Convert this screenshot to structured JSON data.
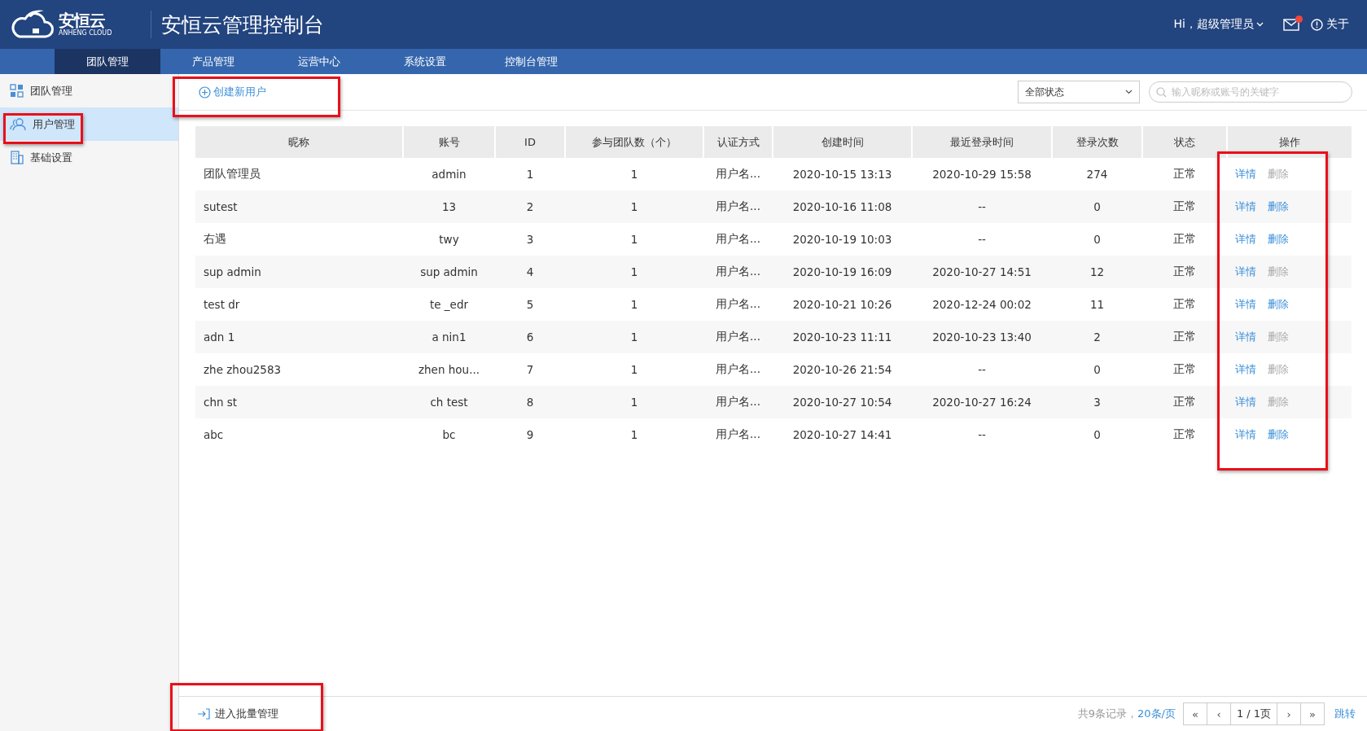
{
  "header": {
    "logo_text": "安恒云",
    "logo_subtext": "ANHENG CLOUD",
    "title": "安恒云管理控制台",
    "greeting": "Hi，超级管理员",
    "mail_unread": true,
    "about": "关于"
  },
  "nav": [
    {
      "label": "团队管理",
      "selected": true
    },
    {
      "label": "产品管理",
      "selected": false
    },
    {
      "label": "运营中心",
      "selected": false
    },
    {
      "label": "系统设置",
      "selected": false
    },
    {
      "label": "控制台管理",
      "selected": false
    }
  ],
  "sidebar": {
    "items": [
      {
        "label": "团队管理",
        "kind": "grid",
        "selected": false
      },
      {
        "label": "用户管理",
        "kind": "users",
        "selected": true
      },
      {
        "label": "基础设置",
        "kind": "building",
        "selected": false
      }
    ]
  },
  "toolbar": {
    "create_button": "创建新用户",
    "status_filter": "全部状态",
    "search": {
      "placeholder": "输入昵称或账号的关键字"
    }
  },
  "table": {
    "columns": [
      "昵称",
      "账号",
      "ID",
      "参与团队数（个）",
      "认证方式",
      "创建时间",
      "最近登录时间",
      "登录次数",
      "状态",
      "操作"
    ],
    "rows": [
      {
        "cells": [
          "团队管理员",
          "admin",
          "1",
          "1",
          "用户名...",
          "2020-10-15 13:13",
          "2020-10-29 15:58",
          "274",
          "正常"
        ],
        "actions": [
          {
            "label": "详情",
            "disabled": false
          },
          {
            "label": "删除",
            "disabled": true
          }
        ]
      },
      {
        "cells": [
          "sutest",
          "13",
          "2",
          "1",
          "用户名...",
          "2020-10-16 11:08",
          "--",
          "0",
          "正常"
        ],
        "actions": [
          {
            "label": "详情",
            "disabled": false
          },
          {
            "label": "删除",
            "disabled": false
          }
        ]
      },
      {
        "cells": [
          "右遇",
          "twy",
          "3",
          "1",
          "用户名...",
          "2020-10-19 10:03",
          "--",
          "0",
          "正常"
        ],
        "actions": [
          {
            "label": "详情",
            "disabled": false
          },
          {
            "label": "删除",
            "disabled": false
          }
        ]
      },
      {
        "cells": [
          "sup admin",
          "sup admin",
          "4",
          "1",
          "用户名...",
          "2020-10-19 16:09",
          "2020-10-27 14:51",
          "12",
          "正常"
        ],
        "actions": [
          {
            "label": "详情",
            "disabled": false
          },
          {
            "label": "删除",
            "disabled": true
          }
        ]
      },
      {
        "cells": [
          "test dr",
          "te _edr",
          "5",
          "1",
          "用户名...",
          "2020-10-21 10:26",
          "2020-12-24 00:02",
          "11",
          "正常"
        ],
        "actions": [
          {
            "label": "详情",
            "disabled": false
          },
          {
            "label": "删除",
            "disabled": false
          }
        ]
      },
      {
        "cells": [
          "adn 1",
          "a nin1",
          "6",
          "1",
          "用户名...",
          "2020-10-23 11:11",
          "2020-10-23 13:40",
          "2",
          "正常"
        ],
        "actions": [
          {
            "label": "详情",
            "disabled": false
          },
          {
            "label": "删除",
            "disabled": true
          }
        ]
      },
      {
        "cells": [
          "zhe zhou2583",
          "zhen hou...",
          "7",
          "1",
          "用户名...",
          "2020-10-26 21:54",
          "--",
          "0",
          "正常"
        ],
        "actions": [
          {
            "label": "详情",
            "disabled": false
          },
          {
            "label": "删除",
            "disabled": true
          }
        ]
      },
      {
        "cells": [
          "chn st",
          "ch test",
          "8",
          "1",
          "用户名...",
          "2020-10-27 10:54",
          "2020-10-27 16:24",
          "3",
          "正常"
        ],
        "actions": [
          {
            "label": "详情",
            "disabled": false
          },
          {
            "label": "删除",
            "disabled": true
          }
        ]
      },
      {
        "cells": [
          "abc",
          "bc",
          "9",
          "1",
          "用户名...",
          "2020-10-27 14:41",
          "--",
          "0",
          "正常"
        ],
        "actions": [
          {
            "label": "详情",
            "disabled": false
          },
          {
            "label": "删除",
            "disabled": false
          }
        ]
      }
    ]
  },
  "footer": {
    "batch": "进入批量管理",
    "summary": "共9条记录，",
    "page_size": "20条/页",
    "first": "«",
    "prev": "‹",
    "page": "1 / 1页",
    "next": "›",
    "last": "»",
    "jump": "跳转"
  }
}
